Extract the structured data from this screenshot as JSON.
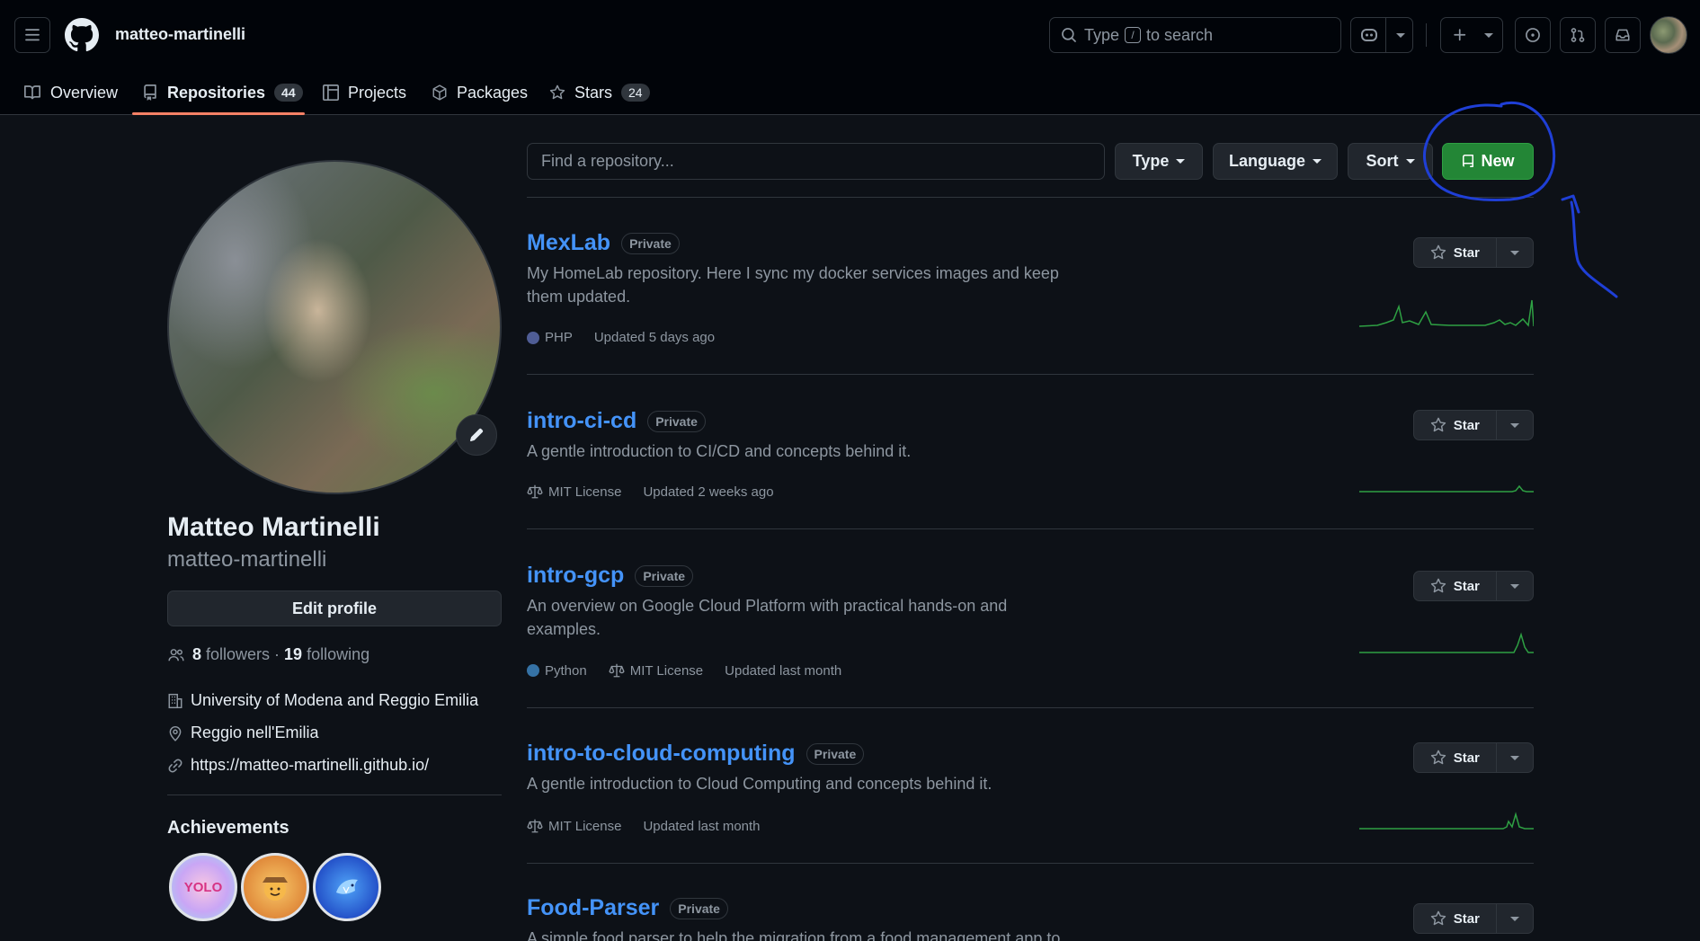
{
  "header": {
    "username": "matteo-martinelli",
    "search_before": "Type",
    "search_key": "/",
    "search_after": "to search"
  },
  "tabs": [
    {
      "label": "Overview"
    },
    {
      "label": "Repositories",
      "count": "44"
    },
    {
      "label": "Projects"
    },
    {
      "label": "Packages"
    },
    {
      "label": "Stars",
      "count": "24"
    }
  ],
  "profile": {
    "name": "Matteo Martinelli",
    "login": "matteo-martinelli",
    "edit_label": "Edit profile",
    "followers_count": "8",
    "followers_label": "followers",
    "separator": "·",
    "following_count": "19",
    "following_label": "following",
    "organization": "University of Modena and Reggio Emilia",
    "location": "Reggio nell'Emilia",
    "website": "https://matteo-martinelli.github.io/",
    "achievements_title": "Achievements"
  },
  "filters": {
    "find_placeholder": "Find a repository...",
    "type_label": "Type",
    "language_label": "Language",
    "sort_label": "Sort",
    "new_label": "New"
  },
  "repos": [
    {
      "name": "MexLab",
      "visibility": "Private",
      "description": "My HomeLab repository. Here I sync my docker services images and keep them updated.",
      "language": "PHP",
      "language_color": "#4F5D95",
      "license": "",
      "updated": "Updated 5 days ago",
      "star_label": "Star"
    },
    {
      "name": "intro-ci-cd",
      "visibility": "Private",
      "description": "A gentle introduction to CI/CD and concepts behind it.",
      "language": "",
      "license": "MIT License",
      "updated": "Updated 2 weeks ago",
      "star_label": "Star"
    },
    {
      "name": "intro-gcp",
      "visibility": "Private",
      "description": "An overview on Google Cloud Platform with practical hands-on and examples.",
      "language": "Python",
      "language_color": "#3572A5",
      "license": "MIT License",
      "updated": "Updated last month",
      "star_label": "Star"
    },
    {
      "name": "intro-to-cloud-computing",
      "visibility": "Private",
      "description": "A gentle introduction to Cloud Computing and concepts behind it.",
      "language": "",
      "license": "MIT License",
      "updated": "Updated last month",
      "star_label": "Star"
    },
    {
      "name": "Food-Parser",
      "visibility": "Private",
      "description": "A simple food parser to help the migration from a food management app to",
      "star_label": "Star"
    }
  ],
  "colors": {
    "accent_link": "#4493f8",
    "primary_button": "#238636",
    "active_tab_underline": "#f78166",
    "annotation_ink": "#1f3fd6",
    "sparkline": "#2ea043"
  },
  "icons": [
    "menu-icon",
    "github-logo-icon",
    "search-icon",
    "copilot-icon",
    "plus-icon",
    "issues-icon",
    "pull-request-icon",
    "inbox-icon",
    "book-icon",
    "repo-icon",
    "project-icon",
    "package-icon",
    "star-icon",
    "people-icon",
    "building-icon",
    "location-icon",
    "link-icon",
    "law-icon",
    "pencil-icon"
  ]
}
